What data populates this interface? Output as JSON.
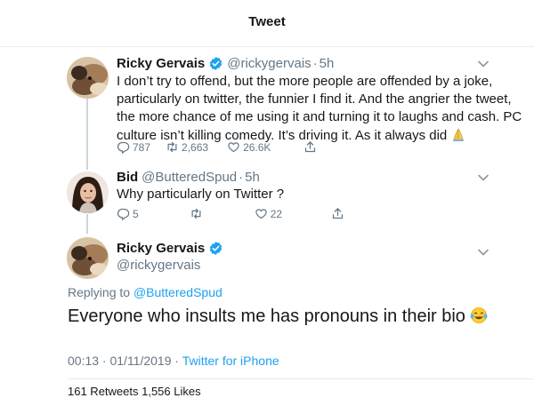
{
  "header": {
    "title": "Tweet"
  },
  "tweets": [
    {
      "display_name": "Ricky Gervais",
      "handle": "@rickygervais",
      "time": "5h",
      "text": "I don’t try to offend, but the more people are offended by a joke, particularly on twitter, the funnier I find it. And the angrier the tweet, the more chance of me using it and turning it to laughs and cash. PC culture isn’t killing comedy. It’s driving it. As it always did",
      "emoji": "folded-hands-emoji",
      "replies": "787",
      "retweets": "2,663",
      "likes": "26.6K"
    },
    {
      "display_name": "Bid",
      "handle": "@ButteredSpud",
      "time": "5h",
      "text": "Why particularly on Twitter ?",
      "replies": "5",
      "retweets": "",
      "likes": "22"
    }
  ],
  "main_tweet": {
    "display_name": "Ricky Gervais",
    "handle": "@rickygervais",
    "replying_prefix": "Replying to",
    "replying_to": "@ButteredSpud",
    "text": "Everyone who insults me has pronouns in their bio",
    "emoji": "laughing-tears-emoji",
    "timestamp": "00:13 · 01/11/2019 ·",
    "source": "Twitter for iPhone",
    "stats": "161 Retweets   1,556 Likes"
  },
  "colors": {
    "accent": "#1da1f2",
    "secondary_text": "#657786",
    "primary_text": "#14171a",
    "divider": "#e6ecf0"
  },
  "icons": [
    "verified-badge-icon",
    "chevron-down-icon",
    "reply-icon",
    "retweet-icon",
    "like-icon",
    "share-icon"
  ]
}
